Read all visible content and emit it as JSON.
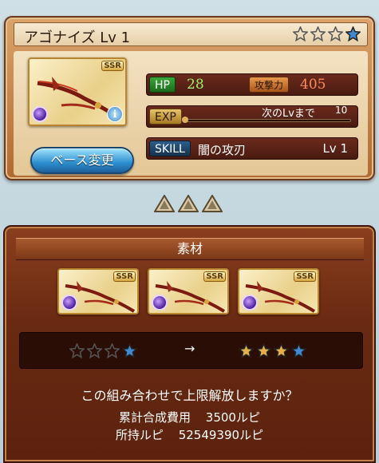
{
  "weapon": {
    "name": "アゴナイズ",
    "level_label": "Lv 1",
    "rarity": "SSR",
    "stars": [
      "empty",
      "empty",
      "empty",
      "blue"
    ],
    "element": "dark",
    "hp_label": "HP",
    "hp_value": "28",
    "atk_label": "攻撃力",
    "atk_value": "405",
    "exp_label": "EXP",
    "exp_next_label": "次のLvまで",
    "exp_next_value": "10",
    "exp_progress": 0,
    "skill_label": "SKILL",
    "skill_name": "闇の攻刃",
    "skill_level": "Lv 1",
    "info_icon": "i"
  },
  "base_change_button": "ベース変更",
  "materials": {
    "header": "素材",
    "items": [
      {
        "rarity": "SSR",
        "element": "dark"
      },
      {
        "rarity": "SSR",
        "element": "dark"
      },
      {
        "rarity": "SSR",
        "element": "dark"
      }
    ]
  },
  "uncap": {
    "before_stars": [
      "empty",
      "empty",
      "empty",
      "blue"
    ],
    "arrow": "→",
    "after_stars": [
      "gold",
      "gold",
      "gold",
      "blue"
    ]
  },
  "confirm_text": "この組み合わせで上限解放しますか？",
  "cost": {
    "total_label": "累計合成費用",
    "total_value": "3500ルピ",
    "owned_label": "所持ルピ",
    "owned_value": "52549390ルピ"
  },
  "colors": {
    "star_empty": "#8c8c8c",
    "star_blue": "#3f8ad0",
    "star_gold": "#e3b04a",
    "hp_value": "#9cf06e",
    "atk_value": "#ff8b5b",
    "button_blue": "#2d8fcf"
  }
}
